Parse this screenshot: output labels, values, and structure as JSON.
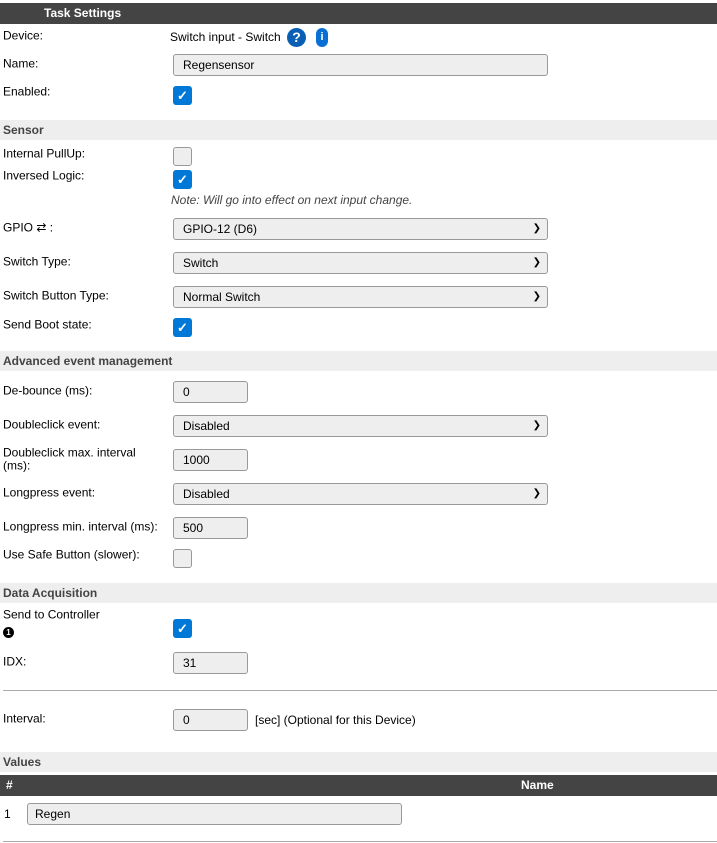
{
  "header": {
    "title": "Task Settings"
  },
  "device": {
    "label": "Device:",
    "value": "Switch input - Switch",
    "help_icon": "question-circle-icon",
    "info_icon": "info-icon"
  },
  "name": {
    "label": "Name:",
    "value": "Regensensor"
  },
  "enabled": {
    "label": "Enabled:",
    "checked": true
  },
  "sensor": {
    "title": "Sensor",
    "pullup": {
      "label": "Internal PullUp:",
      "checked": false
    },
    "inversed": {
      "label": "Inversed Logic:",
      "checked": true,
      "note": "Note: Will go into effect on next input change."
    },
    "gpio": {
      "label": "GPIO ⇄ :",
      "value": "GPIO-12 (D6)"
    },
    "switch_type": {
      "label": "Switch Type:",
      "value": "Switch"
    },
    "button_type": {
      "label": "Switch Button Type:",
      "value": "Normal Switch"
    },
    "boot_state": {
      "label": "Send Boot state:",
      "checked": true
    }
  },
  "advanced": {
    "title": "Advanced event management",
    "debounce": {
      "label": "De-bounce (ms):",
      "value": "0"
    },
    "dblclick": {
      "label": "Doubleclick event:",
      "value": "Disabled"
    },
    "dblclick_interval": {
      "label1": "Doubleclick max. interval",
      "label2": "(ms):",
      "value": "1000"
    },
    "longpress": {
      "label": "Longpress event:",
      "value": "Disabled"
    },
    "longpress_interval": {
      "label": "Longpress min. interval (ms):",
      "value": "500"
    },
    "safe_button": {
      "label": "Use Safe Button (slower):",
      "checked": false
    }
  },
  "data_acq": {
    "title": "Data Acquisition",
    "send": {
      "label": "Send to Controller",
      "badge": "1",
      "checked": true
    },
    "idx": {
      "label": "IDX:",
      "value": "31"
    },
    "interval": {
      "label": "Interval:",
      "value": "0",
      "suffix": "[sec] (Optional for this Device)"
    }
  },
  "values": {
    "title": "Values",
    "col_num": "#",
    "col_name": "Name",
    "rows": [
      {
        "num": "1",
        "name": "Regen"
      }
    ]
  },
  "colors": {
    "accent": "#0078d7",
    "header": "#444444",
    "section": "#eeeeee"
  }
}
